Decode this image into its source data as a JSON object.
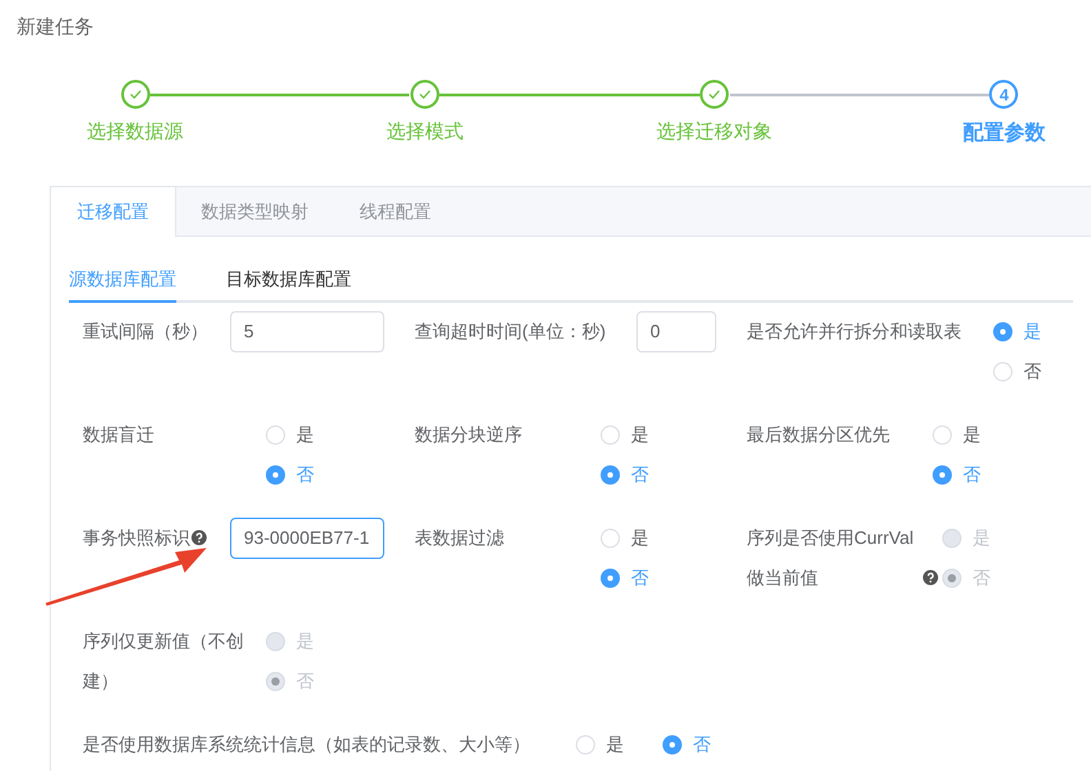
{
  "page_title": "新建任务",
  "steps": [
    {
      "label": "选择数据源",
      "completed": true,
      "active": false
    },
    {
      "label": "选择模式",
      "completed": true,
      "active": false
    },
    {
      "label": "选择迁移对象",
      "completed": true,
      "active": false
    },
    {
      "label": "配置参数",
      "number": "4",
      "completed": false,
      "active": true
    }
  ],
  "tabs": [
    {
      "label": "迁移配置",
      "selected": true
    },
    {
      "label": "数据类型映射",
      "selected": false
    },
    {
      "label": "线程配置",
      "selected": false
    }
  ],
  "sub_tabs": [
    {
      "label": "源数据库配置",
      "selected": true
    },
    {
      "label": "目标数据库配置",
      "selected": false
    }
  ],
  "rows": [
    [
      {
        "kind": "input",
        "label": "重试间隔（秒）",
        "value": "5",
        "focused": false
      },
      {
        "kind": "input",
        "label": "查询超时时间(单位：秒)",
        "value": "0",
        "focused": false
      },
      {
        "kind": "radio",
        "label": "是否允许并行拆分和读取表",
        "disabled": false,
        "options": [
          {
            "label": "是",
            "selected": true
          },
          {
            "label": "否",
            "selected": false
          }
        ]
      }
    ],
    [
      {
        "kind": "radio",
        "label": "数据盲迁",
        "disabled": false,
        "options": [
          {
            "label": "是",
            "selected": false
          },
          {
            "label": "否",
            "selected": true
          }
        ]
      },
      {
        "kind": "radio",
        "label": "数据分块逆序",
        "disabled": false,
        "options": [
          {
            "label": "是",
            "selected": false
          },
          {
            "label": "否",
            "selected": true
          }
        ]
      },
      {
        "kind": "radio",
        "label": "最后数据分区优先",
        "disabled": false,
        "options": [
          {
            "label": "是",
            "selected": false
          },
          {
            "label": "否",
            "selected": true
          }
        ]
      }
    ],
    [
      {
        "kind": "input",
        "label": "事务快照标识",
        "help": true,
        "value": "93-0000EB77-1",
        "focused": true
      },
      {
        "kind": "radio",
        "label": "表数据过滤",
        "disabled": false,
        "options": [
          {
            "label": "是",
            "selected": false
          },
          {
            "label": "否",
            "selected": true
          }
        ]
      },
      {
        "kind": "radio",
        "label": "序列是否使用CurrVal做当前值",
        "help": true,
        "disabled": true,
        "options": [
          {
            "label": "是",
            "selected": false
          },
          {
            "label": "否",
            "selected": true
          }
        ]
      }
    ],
    [
      {
        "kind": "radio",
        "label": "序列仅更新值（不创建）",
        "disabled": true,
        "options": [
          {
            "label": "是",
            "selected": false
          },
          {
            "label": "否",
            "selected": true
          }
        ]
      }
    ],
    [
      {
        "kind": "radio_inline",
        "label": "是否使用数据库系统统计信息（如表的记录数、大小等）",
        "disabled": false,
        "options": [
          {
            "label": "是",
            "selected": false
          },
          {
            "label": "否",
            "selected": true
          }
        ]
      }
    ]
  ]
}
